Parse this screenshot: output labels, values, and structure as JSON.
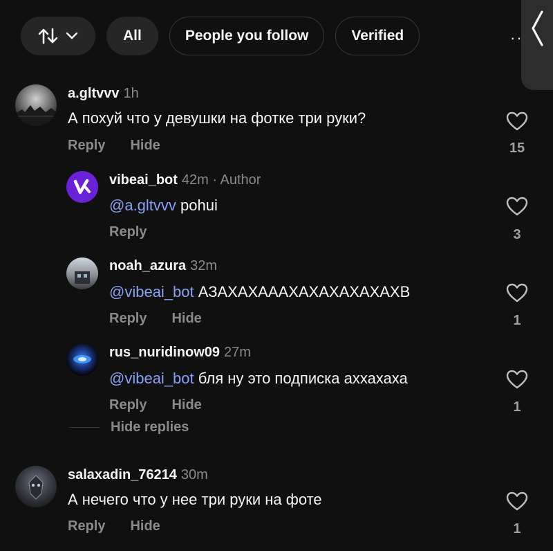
{
  "filters": {
    "all_label": "All",
    "following_label": "People you follow",
    "verified_label": "Verified",
    "more_label": "··"
  },
  "comments": [
    {
      "username": "a.gltvvv",
      "time": "1h",
      "text": "А похуй что у девушки на фотке три руки?",
      "reply_label": "Reply",
      "hide_label": "Hide",
      "likes": "15"
    },
    {
      "username": "vibeai_bot",
      "time": "42m · Author",
      "mention": "@a.gltvvv",
      "text": "pohui",
      "reply_label": "Reply",
      "likes": "3"
    },
    {
      "username": "noah_azura",
      "time": "32m",
      "mention": "@vibeai_bot",
      "text": "АЗАХАХАААХАХАХАХАХАХВ",
      "reply_label": "Reply",
      "hide_label": "Hide",
      "likes": "1"
    },
    {
      "username": "rus_nuridinow09",
      "time": "27m",
      "mention": "@vibeai_bot",
      "text": "бля ну это подписка аххахаха",
      "reply_label": "Reply",
      "hide_label": "Hide",
      "likes": "1"
    },
    {
      "username": "salaxadin_76214",
      "time": "30m",
      "text": "А нечего что у нее три руки на фоте",
      "reply_label": "Reply",
      "hide_label": "Hide",
      "likes": "1"
    }
  ],
  "thread": {
    "hide_replies_label": "Hide replies"
  },
  "colors": {
    "background": "#101010",
    "mention": "#8aa2f5",
    "muted": "#8a8a8a",
    "pill": "#262626"
  }
}
